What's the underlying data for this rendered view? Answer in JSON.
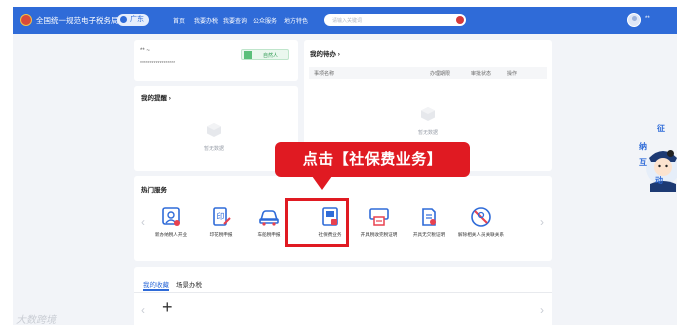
{
  "header": {
    "brand": "全国统一规范电子税务局",
    "region": "广东",
    "nav": [
      "首页",
      "我要办税",
      "我要查询",
      "公众服务",
      "地方特色"
    ],
    "search_placeholder": "请输入关键词",
    "user_name": "**"
  },
  "profile": {
    "name_mask": "** ~",
    "id_mask": "******************",
    "badge": "自然人"
  },
  "reminder": {
    "title": "我的提醒 ›",
    "empty": "暂无数据"
  },
  "todo": {
    "title": "我的待办 ›",
    "columns": [
      "事项名称",
      "办理期限",
      "审批状态",
      "操作"
    ],
    "empty": "暂无数据"
  },
  "hot_services": {
    "title": "热门服务",
    "items": [
      {
        "label": "新办纳税人开业",
        "icon": "store-person-icon"
      },
      {
        "label": "印花税申报",
        "icon": "stamp-edit-icon"
      },
      {
        "label": "车船税申报",
        "icon": "car-icon"
      },
      {
        "label": "社保费业务",
        "icon": "social-insurance-icon"
      },
      {
        "label": "开具税收完税证明",
        "icon": "print-certificate-icon"
      },
      {
        "label": "开具无欠税证明",
        "icon": "document-certificate-icon"
      },
      {
        "label": "解除相关人员关联关系",
        "icon": "unlink-person-icon"
      }
    ]
  },
  "callout": {
    "text": "点击【社保费业务】"
  },
  "tabs": {
    "active": "我的收藏",
    "inactive": "场景办税"
  },
  "assistant": {
    "text_lines": [
      "征",
      "纳",
      "互",
      "动"
    ]
  },
  "watermark": "大数跨境",
  "colors": {
    "primary": "#2f6bd8",
    "highlight": "#e01a22",
    "page_bg": "#f2f4f8"
  }
}
